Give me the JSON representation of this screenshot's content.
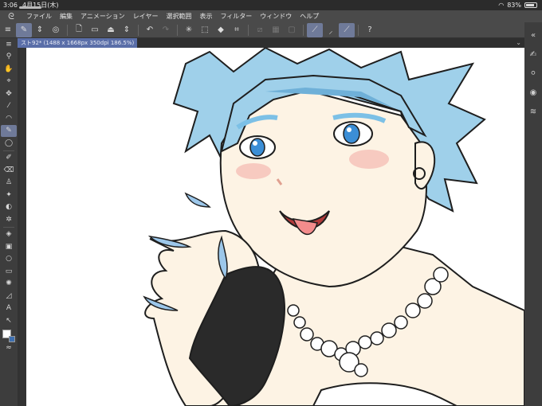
{
  "status": {
    "time": "3:06",
    "date": "4月15日(木)",
    "battery": "83%"
  },
  "menu": [
    "ファイル",
    "編集",
    "アニメーション",
    "レイヤー",
    "選択範囲",
    "表示",
    "フィルター",
    "ウィンドウ",
    "ヘルプ"
  ],
  "toolbar_icons": [
    "brush-settings-icon",
    "updown-icon",
    "shape-icon",
    "new-file-icon",
    "open-file-icon",
    "save-icon",
    "undo-icon",
    "redo-icon",
    "spinner-icon",
    "transform-icon",
    "fill-icon",
    "crop-icon",
    "snap-off-icon",
    "snap-icon",
    "ruler-icon",
    "stroke-icon",
    "pen-pressure-icon",
    "pen-active-icon",
    "help-icon"
  ],
  "tab": {
    "title": "スト92* (1488 x 1668px 350dpi 186.5%)"
  },
  "colors": {
    "accent": "#6f7a99",
    "tab": "#5a6ea8",
    "main_color": "#ffffff",
    "sub_color": "#3e6fb0"
  },
  "illustration": {
    "subject": "Anime character with light-blue spiked hair, blue eyes, tongue out, pearl necklace, black fingerless glove, light-blue long nails",
    "hair": "#9fd0ea",
    "hair_shadow": "#6fb0d8",
    "skin": "#fdf3e4",
    "blush": "#f3b8b0",
    "eye": "#3b8ed6",
    "glove": "#2a2a2a",
    "nails": "#9cc7ea",
    "line": "#1e1e1e"
  }
}
